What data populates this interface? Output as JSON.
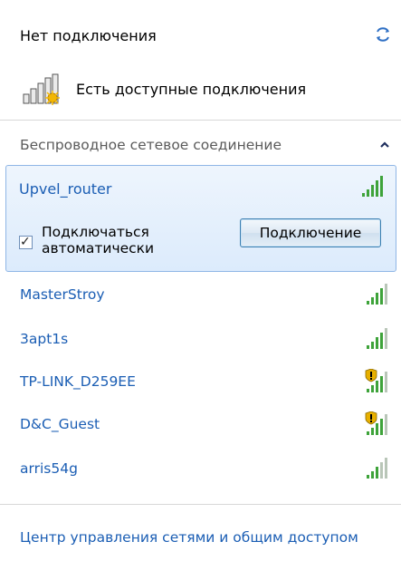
{
  "header": {
    "status": "Нет подключения",
    "available": "Есть доступные подключения"
  },
  "section": {
    "title": "Беспроводное сетевое соединение"
  },
  "selected_network": {
    "name": "Upvel_router",
    "auto_connect_label": "Подключаться автоматически",
    "auto_connect_checked": true,
    "connect_button": "Подключение"
  },
  "networks": [
    {
      "name": "MasterStroy",
      "secured": false
    },
    {
      "name": "3apt1s",
      "secured": false
    },
    {
      "name": "TP-LINK_D259EE",
      "secured": true
    },
    {
      "name": "D&C_Guest",
      "secured": true
    },
    {
      "name": "arris54g",
      "secured": false
    }
  ],
  "footer": {
    "link": "Центр управления сетями и общим доступом"
  },
  "colors": {
    "link": "#1b5eb4",
    "signal": "#3ea33a",
    "selected_bg": "#dcebfc"
  }
}
